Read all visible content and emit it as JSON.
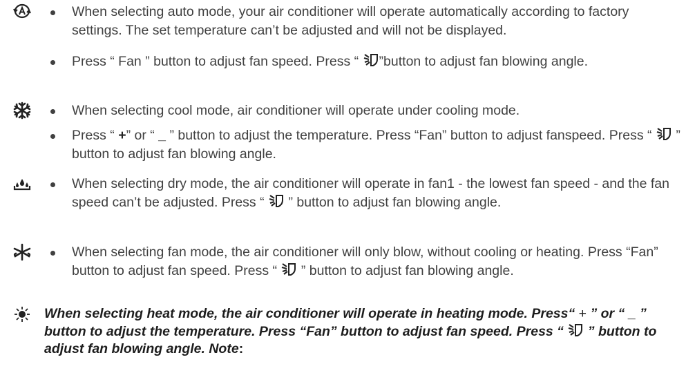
{
  "auto": {
    "icon": "auto-mode-icon",
    "bullet1": "When selecting auto mode, your air conditioner will operate automatically according to factory settings. The set temperature can’t be adjusted and will not be displayed.",
    "bullet2_a": "Press “ Fan ” button to adjust fan speed. Press “",
    "bullet2_b": "”button to adjust fan blowing angle."
  },
  "cool": {
    "icon": "snowflake-icon",
    "bullet1": "When selecting cool mode, air conditioner will operate under cooling mode.",
    "bullet2_a": "Press “",
    "plus": "+",
    "bullet2_b": "” or “",
    "minus": "_",
    "bullet2_c": "” button to adjust the temperature. Press “Fan” button to adjust fanspeed. Press “",
    "bullet2_d": "” button to adjust fan blowing angle."
  },
  "dry": {
    "icon": "water-drops-icon",
    "bullet1_a": "When selecting dry mode, the air conditioner will operate in fan1 - the lowest fan speed - and the fan speed can’t be adjusted. Press “",
    "bullet1_b": "” button to adjust fan blowing angle."
  },
  "fan": {
    "icon": "fan-icon",
    "bullet1_a": "When selecting fan mode, the air conditioner will only blow, without cooling or heating. Press “Fan” button to adjust fan speed. Press “",
    "bullet1_b": "” button to adjust fan blowing angle."
  },
  "heat": {
    "icon": "sun-icon",
    "text_a": "When selecting heat mode, the air conditioner will operate in heating mode. Press“",
    "plus": "+",
    "text_b": "” or “",
    "minus": "_",
    "text_c": "” button to adjust the temperature. Press “Fan” button to adjust fan speed. Press “",
    "text_d": "” button to adjust fan blowing angle. Note",
    "colon": ":"
  }
}
